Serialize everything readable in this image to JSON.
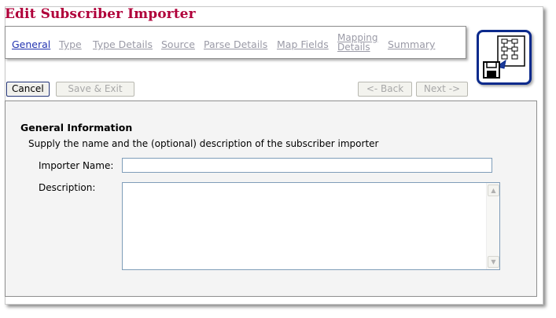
{
  "title": "Edit Subscriber Importer",
  "tabs": [
    {
      "label": "General",
      "active": true
    },
    {
      "label": "Type",
      "active": false
    },
    {
      "label": "Type Details",
      "active": false
    },
    {
      "label": "Source",
      "active": false
    },
    {
      "label": "Parse Details",
      "active": false
    },
    {
      "label": "Map Fields",
      "active": false
    },
    {
      "label_line1": "Mapping",
      "label_line2": "Details",
      "active": false
    },
    {
      "label": "Summary",
      "active": false
    }
  ],
  "buttons": {
    "cancel": "Cancel",
    "save_exit": "Save & Exit",
    "back": "<- Back",
    "next": "Next ->"
  },
  "section": {
    "title": "General Information",
    "description": "Supply the name and the (optional) description of the subscriber importer"
  },
  "fields": {
    "importer_name_label": "Importer Name:",
    "importer_name_value": "",
    "description_label": "Description:",
    "description_value": ""
  },
  "icons": {
    "wizard": "save-wizard-icon",
    "scroll_up": "scroll-up-arrow-icon",
    "scroll_down": "scroll-down-arrow-icon"
  },
  "colors": {
    "title": "#b0003a",
    "active_tab": "#2233b0",
    "inactive_tab": "#9a9aa6",
    "icon_border": "#0b2a8c",
    "panel_bg": "#f4f4f4"
  }
}
